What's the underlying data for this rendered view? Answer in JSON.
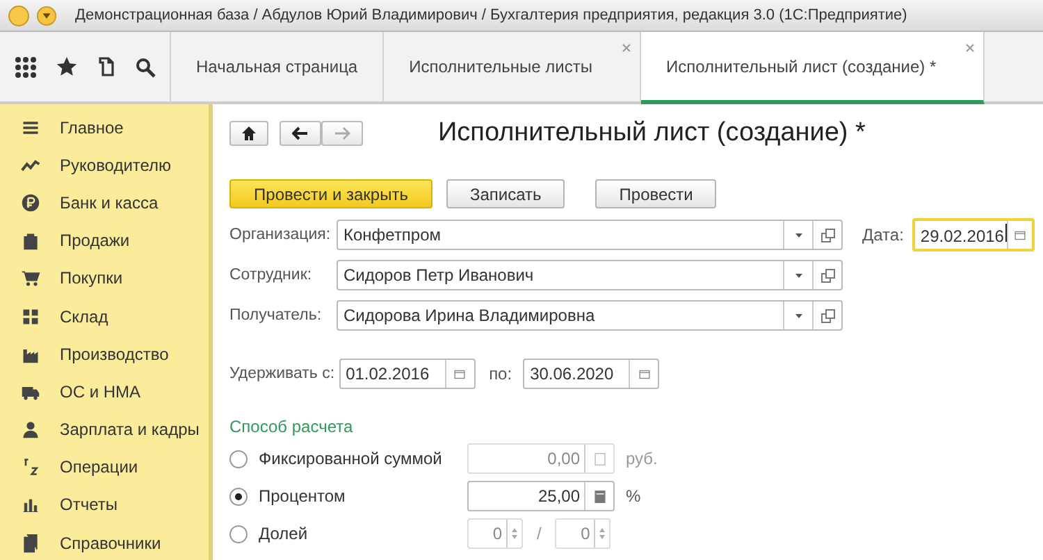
{
  "window": {
    "title": "Демонстрационная база / Абдулов Юрий Владимирович / Бухгалтерия предприятия, редакция 3.0  (1С:Предприятие)"
  },
  "tabs": [
    {
      "label": "Начальная страница",
      "selected": false,
      "closable": false
    },
    {
      "label": "Исполнительные листы",
      "selected": false,
      "closable": true
    },
    {
      "label": "Исполнительный лист (создание) *",
      "selected": true,
      "closable": true
    }
  ],
  "sidebar": {
    "items": [
      {
        "label": "Главное"
      },
      {
        "label": "Руководителю"
      },
      {
        "label": "Банк и касса"
      },
      {
        "label": "Продажи"
      },
      {
        "label": "Покупки"
      },
      {
        "label": "Склад"
      },
      {
        "label": "Производство"
      },
      {
        "label": "ОС и НМА"
      },
      {
        "label": "Зарплата и кадры"
      },
      {
        "label": "Операции"
      },
      {
        "label": "Отчеты"
      },
      {
        "label": "Справочники"
      }
    ]
  },
  "form": {
    "title": "Исполнительный лист (создание) *",
    "buttons": [
      {
        "label": "Провести и закрыть",
        "kind": "primary"
      },
      {
        "label": "Записать",
        "kind": "normal"
      },
      {
        "label": "Провести",
        "kind": "normal"
      }
    ],
    "fields": [
      {
        "label": "Организация:",
        "value": "Конфетпром"
      },
      {
        "label": "Сотрудник:",
        "value": "Сидоров Петр Иванович"
      },
      {
        "label": "Получатель:",
        "value": "Сидорова Ирина Владимировна"
      }
    ],
    "date": {
      "label": "Дата:",
      "value": "29.02.2016",
      "focused": true
    },
    "period": {
      "from_label": "Удерживать с:",
      "from": "01.02.2016",
      "to_label": "по:",
      "to": "30.06.2020"
    },
    "method": {
      "title": "Способ расчета",
      "options": [
        {
          "label": "Фиксированной суммой",
          "selected": false,
          "kind": "amount",
          "value": "0,00",
          "unit": "руб."
        },
        {
          "label": "Процентом",
          "selected": true,
          "kind": "amount",
          "value": "25,00",
          "unit": "%"
        },
        {
          "label": "Долей",
          "selected": false,
          "kind": "share",
          "numerator": "0",
          "separator": "/",
          "denominator": "0"
        }
      ]
    }
  }
}
